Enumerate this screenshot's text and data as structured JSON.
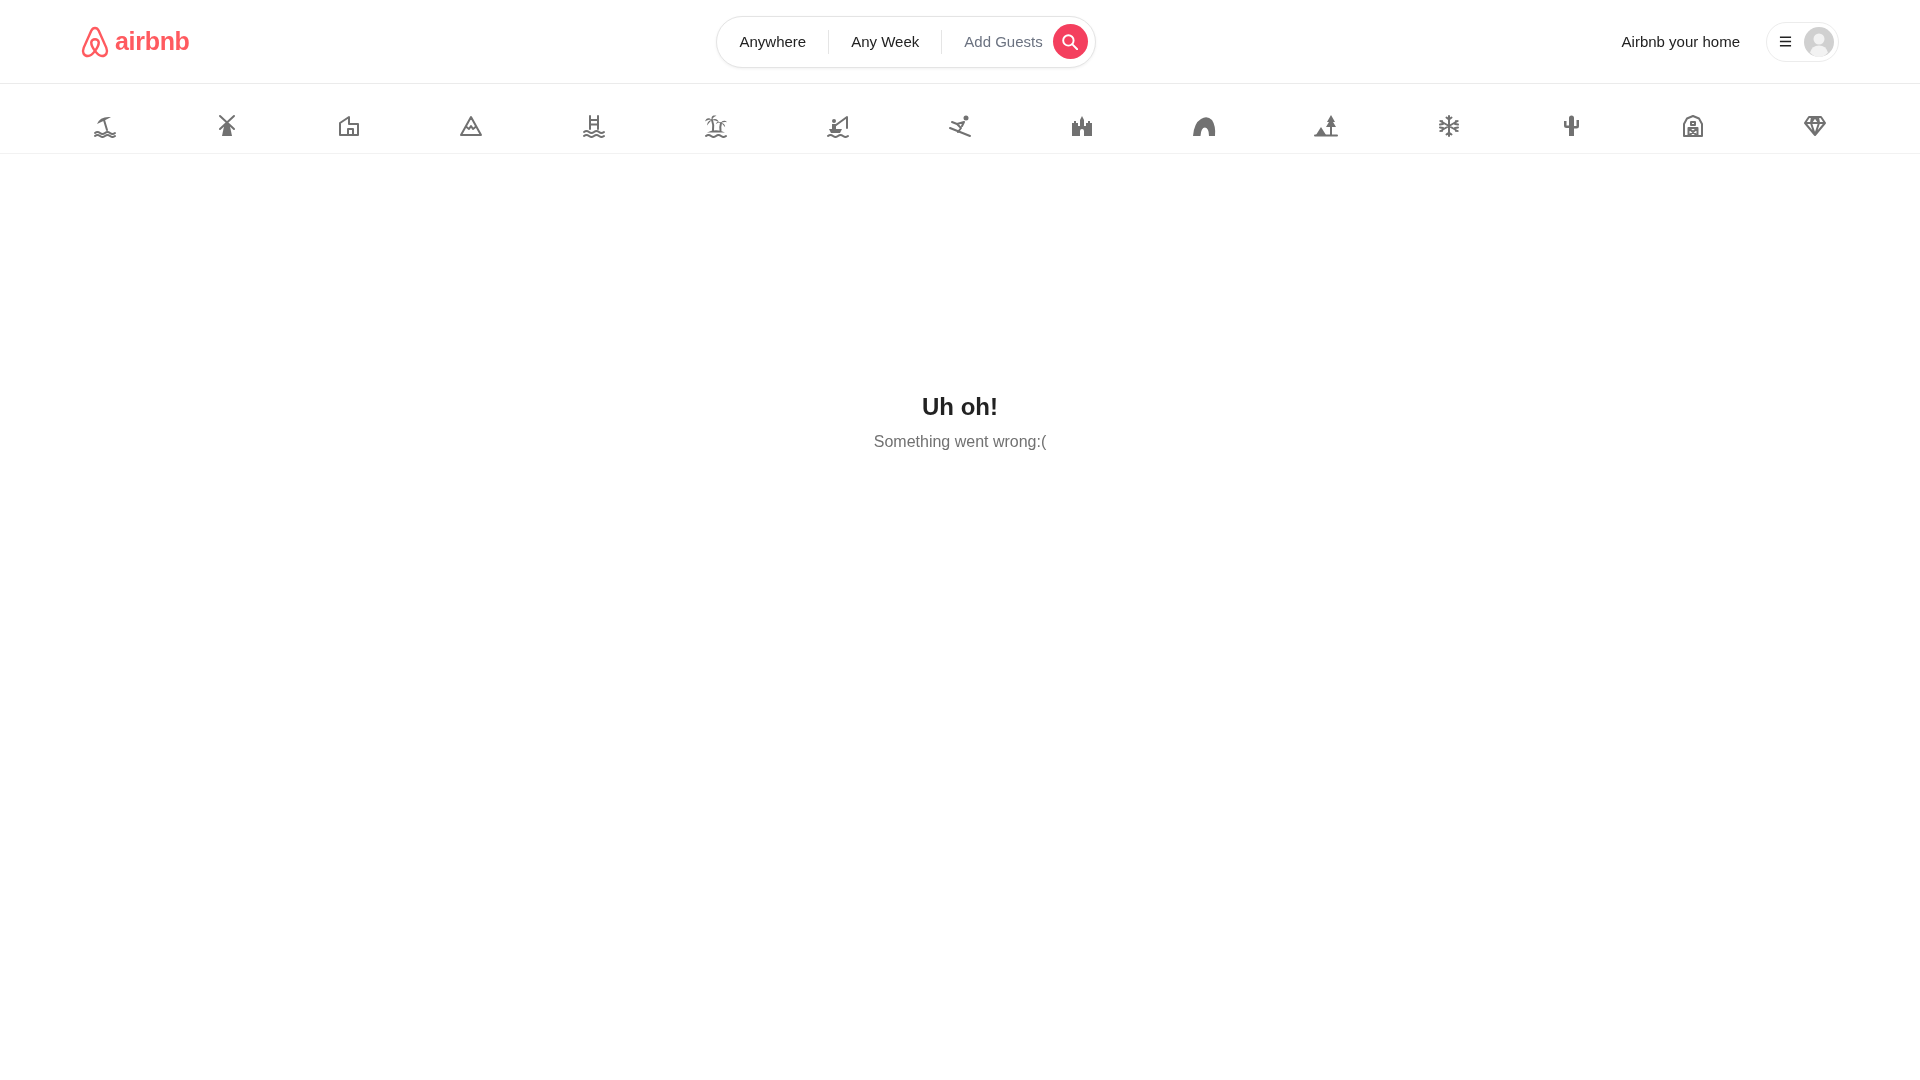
{
  "header": {
    "logo": {
      "text": "airbnb"
    },
    "search": {
      "items": [
        {
          "label": "Anywhere",
          "muted": false
        },
        {
          "label": "Any Week",
          "muted": false
        },
        {
          "label": "Add Guests",
          "muted": true
        }
      ]
    },
    "host_link": "Airbnb your home"
  },
  "categories": [
    {
      "kind": "beach"
    },
    {
      "kind": "windmill"
    },
    {
      "kind": "house"
    },
    {
      "kind": "peak"
    },
    {
      "kind": "pool"
    },
    {
      "kind": "palms"
    },
    {
      "kind": "fishing"
    },
    {
      "kind": "skier"
    },
    {
      "kind": "castle"
    },
    {
      "kind": "cave"
    },
    {
      "kind": "camping"
    },
    {
      "kind": "snowflake"
    },
    {
      "kind": "cactus"
    },
    {
      "kind": "barn"
    },
    {
      "kind": "diamond"
    }
  ],
  "message": {
    "title": "Uh oh!",
    "subtitle": "Something went wrong:("
  }
}
